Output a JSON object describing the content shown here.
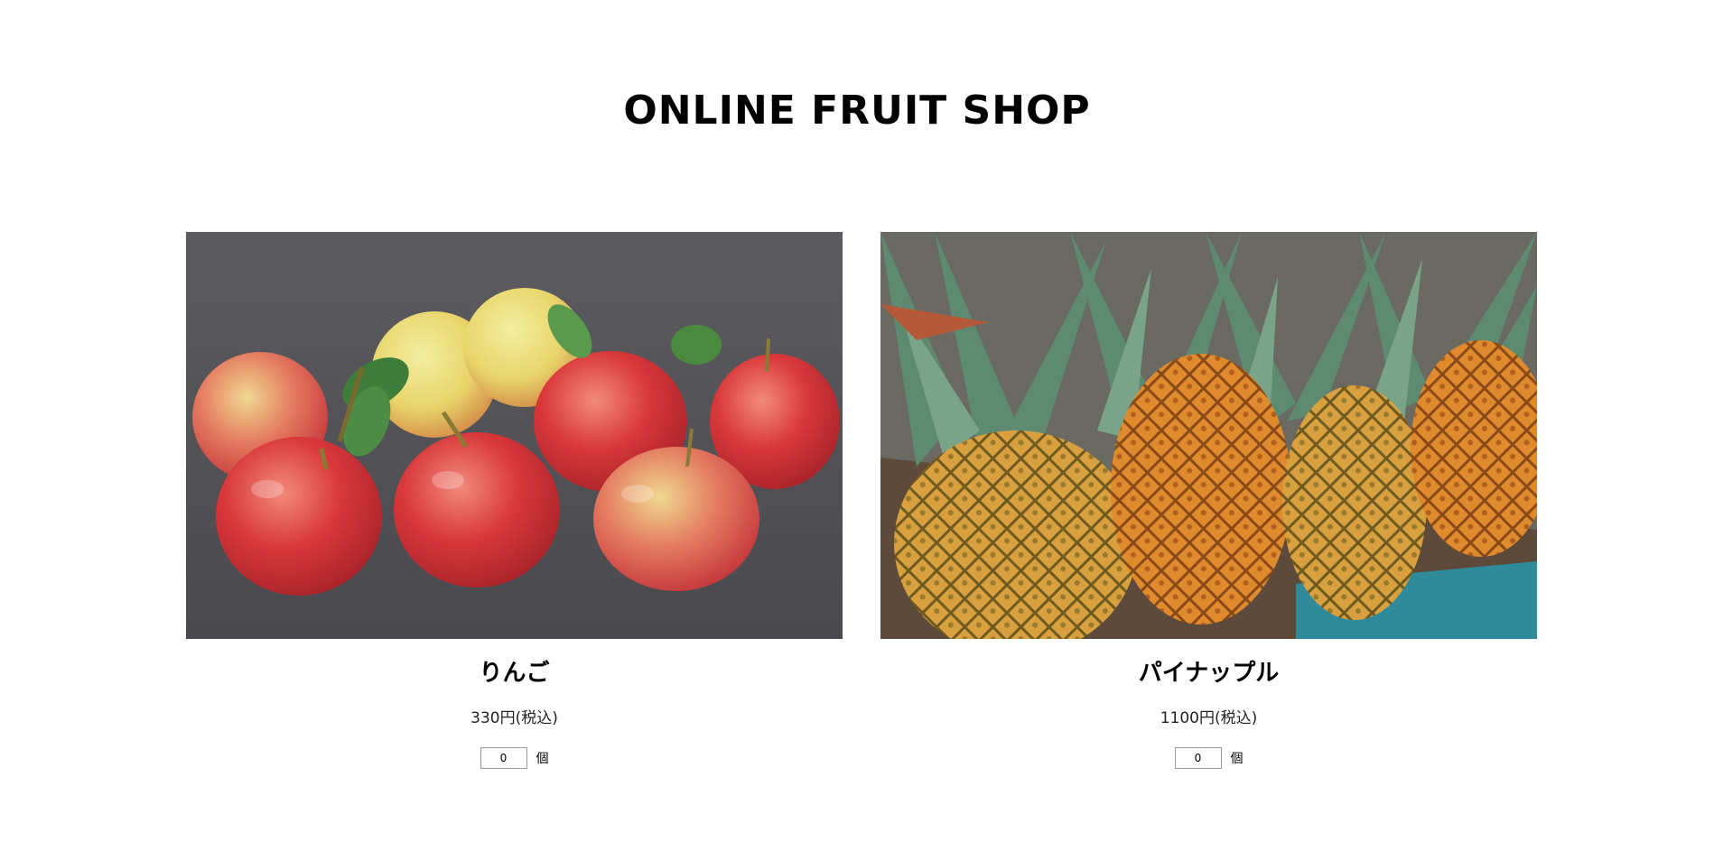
{
  "site": {
    "title": "ONLINE FRUIT SHOP"
  },
  "products": [
    {
      "name": "りんご",
      "price": "330円(税込)",
      "quantity": "0",
      "unit": "個",
      "image": "apples-photo"
    },
    {
      "name": "パイナップル",
      "price": "1100円(税込)",
      "quantity": "0",
      "unit": "個",
      "image": "pineapples-photo"
    }
  ],
  "colors": {
    "background": "#ffffff",
    "text": "#000000",
    "input_border": "#999999"
  }
}
